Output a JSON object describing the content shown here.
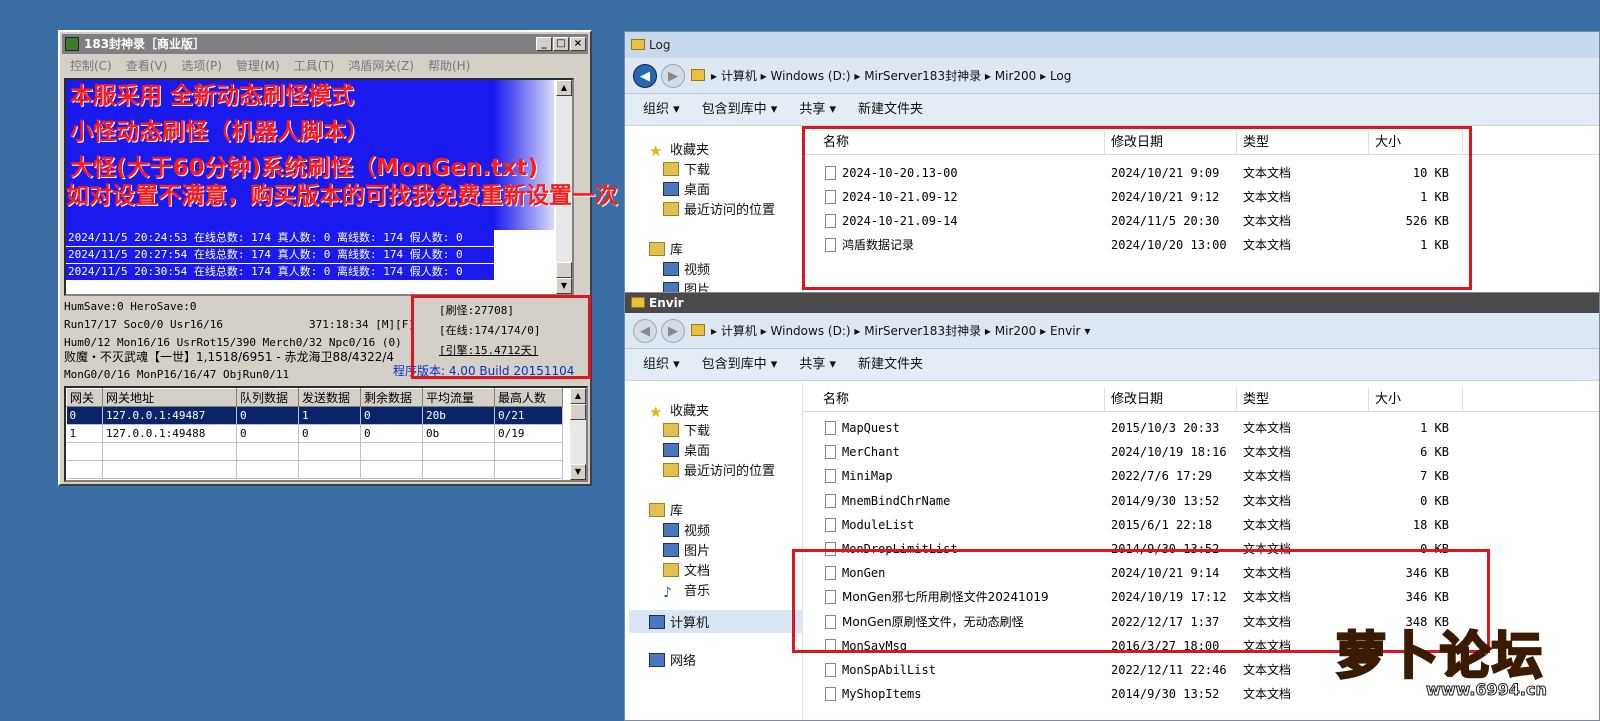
{
  "server": {
    "title": "183封神录［商业版］",
    "menu": [
      "控制(C)",
      "查看(V)",
      "选项(P)",
      "管理(M)",
      "工具(T)",
      "鸿盾网关(Z)",
      "帮助(H)"
    ],
    "promo": [
      "本服采用 全新动态刷怪模式",
      "小怪动态刷怪（机器人脚本）",
      "大怪(大于60分钟)系统刷怪（MonGen.txt)",
      "如对设置不满意，购买版本的可找我免费重新设置一次"
    ],
    "log": [
      "2024/11/5 20:24:53 在线总数: 174 真人数: 0 离线数: 174 假人数: 0",
      "2024/11/5 20:27:54 在线总数: 174 真人数: 0 离线数: 174 假人数: 0",
      "2024/11/5 20:30:54 在线总数: 174 真人数: 0 离线数: 174 假人数: 0"
    ],
    "stats": [
      "HumSave:0 HeroSave:0",
      "Run17/17 Soc0/0 Usr16/16",
      "Hum0/12 Mon16/16 UsrRot15/390 Merch0/32 Npc0/16 (0)",
      "败魔・不灭武魂【一世】1,1518/6951 - 赤龙海卫88/4322/4",
      "MonG0/0/16 MonP16/16/47 ObjRun0/11"
    ],
    "time_readout": "371:18:34 [M][F]",
    "box": [
      "[刷怪:27708]",
      "[在线:174/174/0]",
      "[引擎:15.4712天]"
    ],
    "build": "程序版本: 4.00 Build 20151104",
    "gate_headers": [
      "网关",
      "网关地址",
      "队列数据",
      "发送数据",
      "剩余数据",
      "平均流量",
      "最高人数"
    ],
    "gate_rows": [
      [
        "0",
        "127.0.0.1:49487",
        "0",
        "1",
        "0",
        "20b",
        "0/21"
      ],
      [
        "1",
        "127.0.0.1:49488",
        "0",
        "0",
        "0",
        "0b",
        "0/19"
      ]
    ]
  },
  "log_window": {
    "title": "Log",
    "path": [
      "计算机",
      "Windows (D:)",
      "MirServer183封神录",
      "Mir200",
      "Log"
    ],
    "toolbar": [
      "组织 ▾",
      "包含到库中 ▾",
      "共享 ▾",
      "新建文件夹"
    ],
    "nav": [
      "收藏夹",
      "下载",
      "桌面",
      "最近访问的位置",
      "库",
      "视频",
      "图片"
    ],
    "columns": [
      "名称",
      "修改日期",
      "类型",
      "大小"
    ],
    "files": [
      {
        "name": "2024-10-20.13-00",
        "date": "2024/10/21 9:09",
        "type": "文本文档",
        "size": "10 KB"
      },
      {
        "name": "2024-10-21.09-12",
        "date": "2024/10/21 9:12",
        "type": "文本文档",
        "size": "1 KB"
      },
      {
        "name": "2024-10-21.09-14",
        "date": "2024/11/5 20:30",
        "type": "文本文档",
        "size": "526 KB"
      },
      {
        "name": "鸿盾数据记录",
        "date": "2024/10/20 13:00",
        "type": "文本文档",
        "size": "1 KB"
      }
    ]
  },
  "envir_window": {
    "title": "Envir",
    "path": [
      "计算机",
      "Windows (D:)",
      "MirServer183封神录",
      "Mir200",
      "Envir"
    ],
    "toolbar": [
      "组织 ▾",
      "包含到库中 ▾",
      "共享 ▾",
      "新建文件夹"
    ],
    "nav": [
      "收藏夹",
      "下载",
      "桌面",
      "最近访问的位置",
      "库",
      "视频",
      "图片",
      "文档",
      "音乐",
      "计算机",
      "网络"
    ],
    "columns": [
      "名称",
      "修改日期",
      "类型",
      "大小"
    ],
    "files": [
      {
        "name": "MapQuest",
        "date": "2015/10/3 20:33",
        "type": "文本文档",
        "size": "1 KB"
      },
      {
        "name": "MerChant",
        "date": "2024/10/19 18:16",
        "type": "文本文档",
        "size": "6 KB"
      },
      {
        "name": "MiniMap",
        "date": "2022/7/6 17:29",
        "type": "文本文档",
        "size": "7 KB"
      },
      {
        "name": "MnemBindChrName",
        "date": "2014/9/30 13:52",
        "type": "文本文档",
        "size": "0 KB"
      },
      {
        "name": "ModuleList",
        "date": "2015/6/1 22:18",
        "type": "文本文档",
        "size": "18 KB"
      },
      {
        "name": "MonDropLimitList",
        "date": "2014/9/30 13:52",
        "type": "文本文档",
        "size": "0 KB"
      },
      {
        "name": "MonGen",
        "date": "2024/10/21 9:14",
        "type": "文本文档",
        "size": "346 KB"
      },
      {
        "name": "MonGen邪七所用刷怪文件20241019",
        "date": "2024/10/19 17:12",
        "type": "文本文档",
        "size": "346 KB"
      },
      {
        "name": "MonGen原刷怪文件，无动态刷怪",
        "date": "2022/12/17 1:37",
        "type": "文本文档",
        "size": "348 KB"
      },
      {
        "name": "MonSayMsg",
        "date": "2016/3/27 18:00",
        "type": "文本文档",
        "size": ""
      },
      {
        "name": "MonSpAbilList",
        "date": "2022/12/11 22:46",
        "type": "文本文档",
        "size": ""
      },
      {
        "name": "MyShopItems",
        "date": "2014/9/30 13:52",
        "type": "文本文档",
        "size": ""
      }
    ]
  },
  "watermark": {
    "text": "萝卜论坛",
    "url": "www.6994.cn"
  },
  "colors": {
    "desktop": "#3a6ea5",
    "highlight": "#e0141e",
    "log_blue": "#1a1aee"
  }
}
